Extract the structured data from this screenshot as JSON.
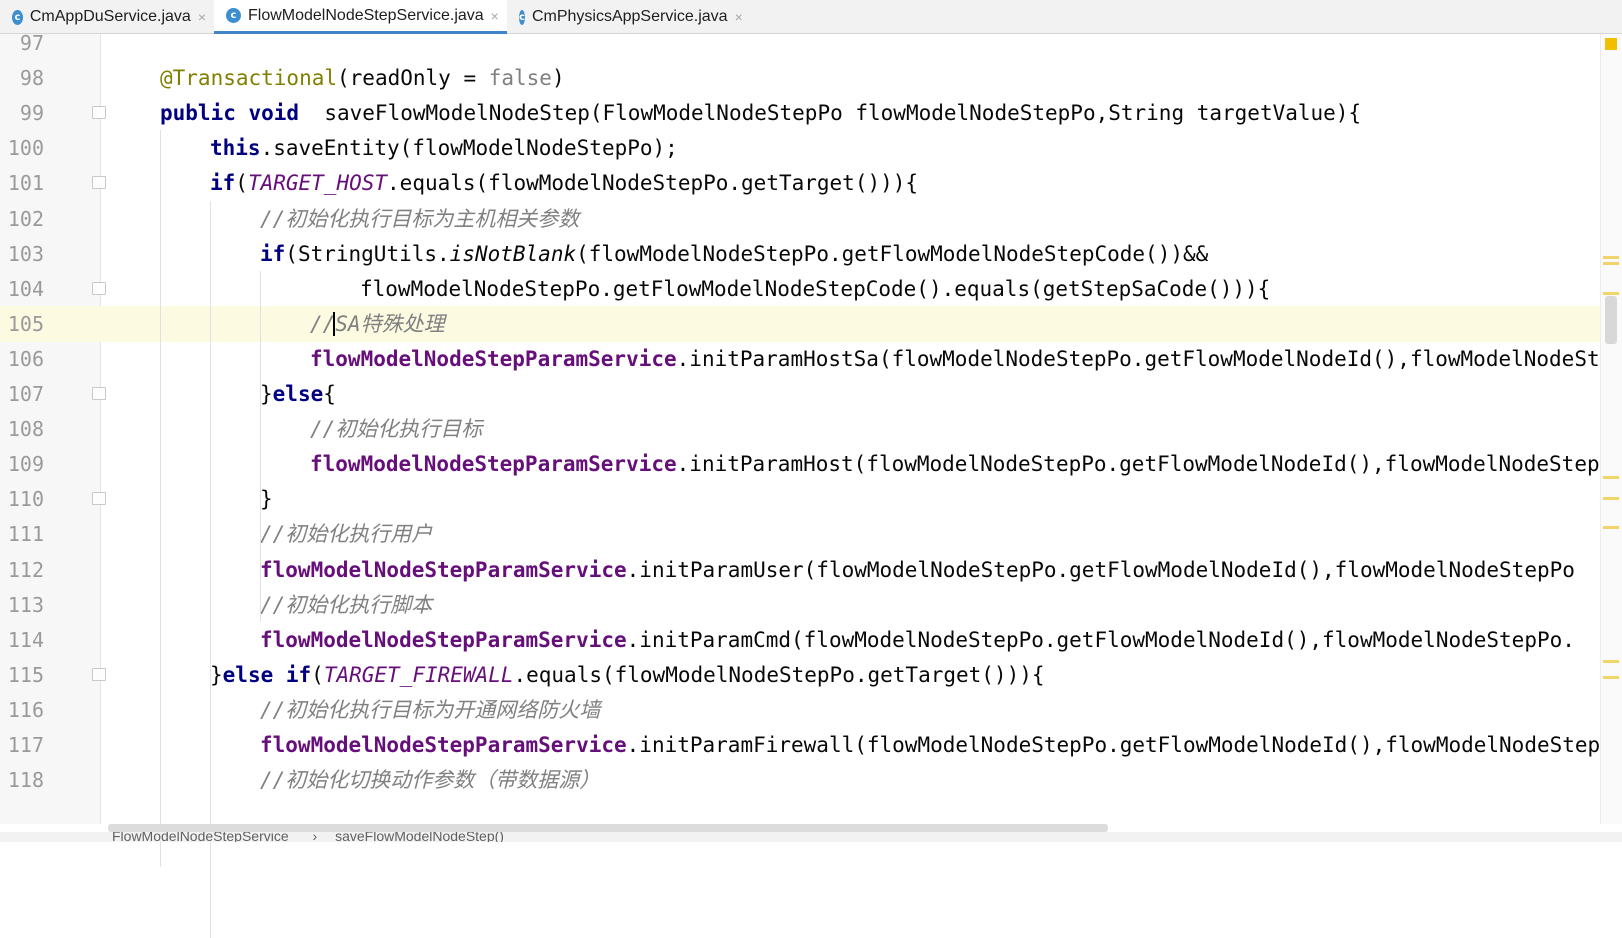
{
  "tabs": [
    {
      "label": "CmAppDuService.java",
      "icon": "java-class-icon",
      "icon_letter": "c",
      "active": false
    },
    {
      "label": "FlowModelNodeStepService.java",
      "icon": "java-class-icon",
      "icon_letter": "c",
      "active": true
    },
    {
      "label": "CmPhysicsAppService.java",
      "icon": "java-class-icon",
      "icon_letter": "c",
      "active": false
    }
  ],
  "tab_close_glyph": "×",
  "editor": {
    "lines": [
      {
        "n": "97",
        "segs": []
      },
      {
        "n": "98",
        "segs": [
          [
            "ann",
            "@Transactional"
          ],
          [
            "",
            "(readOnly = "
          ],
          [
            "lit",
            "false"
          ],
          [
            "",
            ")"
          ]
        ]
      },
      {
        "n": "99",
        "segs": [
          [
            "kw",
            "public void"
          ],
          [
            "",
            "  saveFlowModelNodeStep(FlowModelNodeStepPo flowModelNodeStepPo,String targetValue){"
          ]
        ]
      },
      {
        "n": "100",
        "segs": [
          [
            "kw",
            "this"
          ],
          [
            "",
            ".saveEntity(flowModelNodeStepPo);"
          ]
        ]
      },
      {
        "n": "101",
        "segs": [
          [
            "kw",
            "if"
          ],
          [
            "",
            "("
          ],
          [
            "cst",
            "TARGET_HOST"
          ],
          [
            "",
            ".equals(flowModelNodeStepPo.getTarget())){"
          ]
        ]
      },
      {
        "n": "102",
        "segs": [
          [
            "cmt",
            "//初始化执行目标为主机相关参数"
          ]
        ]
      },
      {
        "n": "103",
        "segs": [
          [
            "kw",
            "if"
          ],
          [
            "",
            "(StringUtils."
          ],
          [
            "ital",
            "isNotBlank"
          ],
          [
            "",
            "(flowModelNodeStepPo.getFlowModelNodeStepCode())&&"
          ]
        ]
      },
      {
        "n": "104",
        "segs": [
          [
            "",
            "flowModelNodeStepPo.getFlowModelNodeStepCode().equals(getStepSaCode())){"
          ]
        ]
      },
      {
        "n": "105",
        "segs": [
          [
            "cmt",
            "//SA特殊处理"
          ]
        ]
      },
      {
        "n": "106",
        "segs": [
          [
            "fld",
            "flowModelNodeStepParamService"
          ],
          [
            "",
            ".initParamHostSa(flowModelNodeStepPo.getFlowModelNodeId(),flowModelNodeStepPo"
          ]
        ]
      },
      {
        "n": "107",
        "segs": [
          [
            "",
            "}"
          ],
          [
            "kw",
            "else"
          ],
          [
            "",
            "{"
          ]
        ]
      },
      {
        "n": "108",
        "segs": [
          [
            "cmt",
            "//初始化执行目标"
          ]
        ]
      },
      {
        "n": "109",
        "segs": [
          [
            "fld",
            "flowModelNodeStepParamService"
          ],
          [
            "",
            ".initParamHost(flowModelNodeStepPo.getFlowModelNodeId(),flowModelNodeStepPo"
          ]
        ]
      },
      {
        "n": "110",
        "segs": [
          [
            "",
            "}"
          ]
        ]
      },
      {
        "n": "111",
        "segs": [
          [
            "cmt",
            "//初始化执行用户"
          ]
        ]
      },
      {
        "n": "112",
        "segs": [
          [
            "fld",
            "flowModelNodeStepParamService"
          ],
          [
            "",
            ".initParamUser(flowModelNodeStepPo.getFlowModelNodeId(),flowModelNodeStepPo"
          ]
        ]
      },
      {
        "n": "113",
        "segs": [
          [
            "cmt",
            "//初始化执行脚本"
          ]
        ]
      },
      {
        "n": "114",
        "segs": [
          [
            "fld",
            "flowModelNodeStepParamService"
          ],
          [
            "",
            ".initParamCmd(flowModelNodeStepPo.getFlowModelNodeId(),flowModelNodeStepPo."
          ]
        ]
      },
      {
        "n": "115",
        "segs": [
          [
            "",
            "}"
          ],
          [
            "kw",
            "else if"
          ],
          [
            "",
            "("
          ],
          [
            "cst",
            "TARGET_FIREWALL"
          ],
          [
            "",
            ".equals(flowModelNodeStepPo.getTarget())){"
          ]
        ]
      },
      {
        "n": "116",
        "segs": [
          [
            "cmt",
            "//初始化执行目标为开通网络防火墙"
          ]
        ]
      },
      {
        "n": "117",
        "segs": [
          [
            "fld",
            "flowModelNodeStepParamService"
          ],
          [
            "",
            ".initParamFirewall(flowModelNodeStepPo.getFlowModelNodeId(),flowModelNodeStepPo"
          ]
        ]
      },
      {
        "n": "118",
        "segs": [
          [
            "cmt",
            "//初始化切换动作参数（带数据源）"
          ]
        ]
      }
    ]
  },
  "breadcrumb": {
    "class_name": "FlowModelNodeStepService",
    "separator": "›",
    "method_name": "saveFlowModelNodeStep()"
  },
  "colors": {
    "keyword": "#000080",
    "annotation": "#808000",
    "comment": "#808080",
    "field": "#660e7a",
    "caret_line": "#fcfbe2",
    "tab_underline": "#4083c9"
  }
}
